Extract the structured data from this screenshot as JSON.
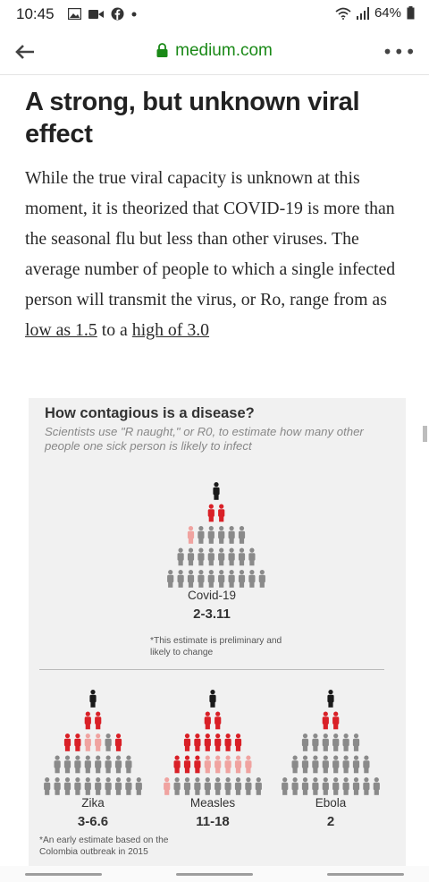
{
  "status_bar": {
    "time": "10:45",
    "battery": "64%",
    "left_icons": [
      "image-icon",
      "video-icon",
      "facebook-icon",
      "dot-icon"
    ],
    "right_icons": [
      "wifi-icon",
      "signal-icon",
      "battery-icon"
    ]
  },
  "browser": {
    "url": "medium.com",
    "back_icon": "back-arrow-icon",
    "menu_icon": "more-dots-icon",
    "menu_label": "•••",
    "accent_color": "#1a8917"
  },
  "article": {
    "title": "A strong, but unknown viral effect",
    "body_before": "While the true viral capacity is unknown at this moment, it is theorized that COVID-19 is more than the seasonal flu but less than other viruses. The average number of people to which a single infected person will transmit the virus, or Ro, range from as ",
    "link_low": "low as 1.5",
    "body_middle": " to a ",
    "link_high": "high of 3.0"
  },
  "infographic": {
    "title": "How contagious is a disease?",
    "subtitle": "Scientists use \"R naught,\" or R0, to estimate how many other people one sick person is likely to infect",
    "colors": {
      "patient": "#1a1a1a",
      "red": "#d92027",
      "pink": "#f0a3a0",
      "grey": "#8a8a8a"
    },
    "diseases": [
      {
        "name": "Covid-19",
        "value": "2-3.11",
        "note": "*This estimate is preliminary and likely to change",
        "rows": [
          [
            "k"
          ],
          [
            "r",
            "r"
          ],
          [
            "p",
            "g",
            "g",
            "g",
            "g",
            "g"
          ],
          [
            "g",
            "g",
            "g",
            "g",
            "g",
            "g",
            "g",
            "g"
          ],
          [
            "g",
            "g",
            "g",
            "g",
            "g",
            "g",
            "g",
            "g",
            "g",
            "g"
          ]
        ]
      },
      {
        "name": "Zika",
        "value": "3-6.6",
        "note": "*An early estimate based on the Colombia outbreak in 2015",
        "rows": [
          [
            "k"
          ],
          [
            "r",
            "r"
          ],
          [
            "r",
            "r",
            "p",
            "p",
            "g",
            "r"
          ],
          [
            "g",
            "g",
            "g",
            "g",
            "g",
            "g",
            "g",
            "g"
          ],
          [
            "g",
            "g",
            "g",
            "g",
            "g",
            "g",
            "g",
            "g",
            "g",
            "g"
          ]
        ]
      },
      {
        "name": "Measles",
        "value": "11-18",
        "note": "",
        "rows": [
          [
            "k"
          ],
          [
            "r",
            "r"
          ],
          [
            "r",
            "r",
            "r",
            "r",
            "r",
            "r"
          ],
          [
            "r",
            "r",
            "r",
            "p",
            "p",
            "p",
            "p",
            "p"
          ],
          [
            "p",
            "g",
            "g",
            "g",
            "g",
            "g",
            "g",
            "g",
            "g",
            "g"
          ]
        ]
      },
      {
        "name": "Ebola",
        "value": "2",
        "note": "",
        "rows": [
          [
            "k"
          ],
          [
            "r",
            "r"
          ],
          [
            "g",
            "g",
            "g",
            "g",
            "g",
            "g"
          ],
          [
            "g",
            "g",
            "g",
            "g",
            "g",
            "g",
            "g",
            "g"
          ],
          [
            "g",
            "g",
            "g",
            "g",
            "g",
            "g",
            "g",
            "g",
            "g",
            "g"
          ]
        ]
      }
    ]
  }
}
